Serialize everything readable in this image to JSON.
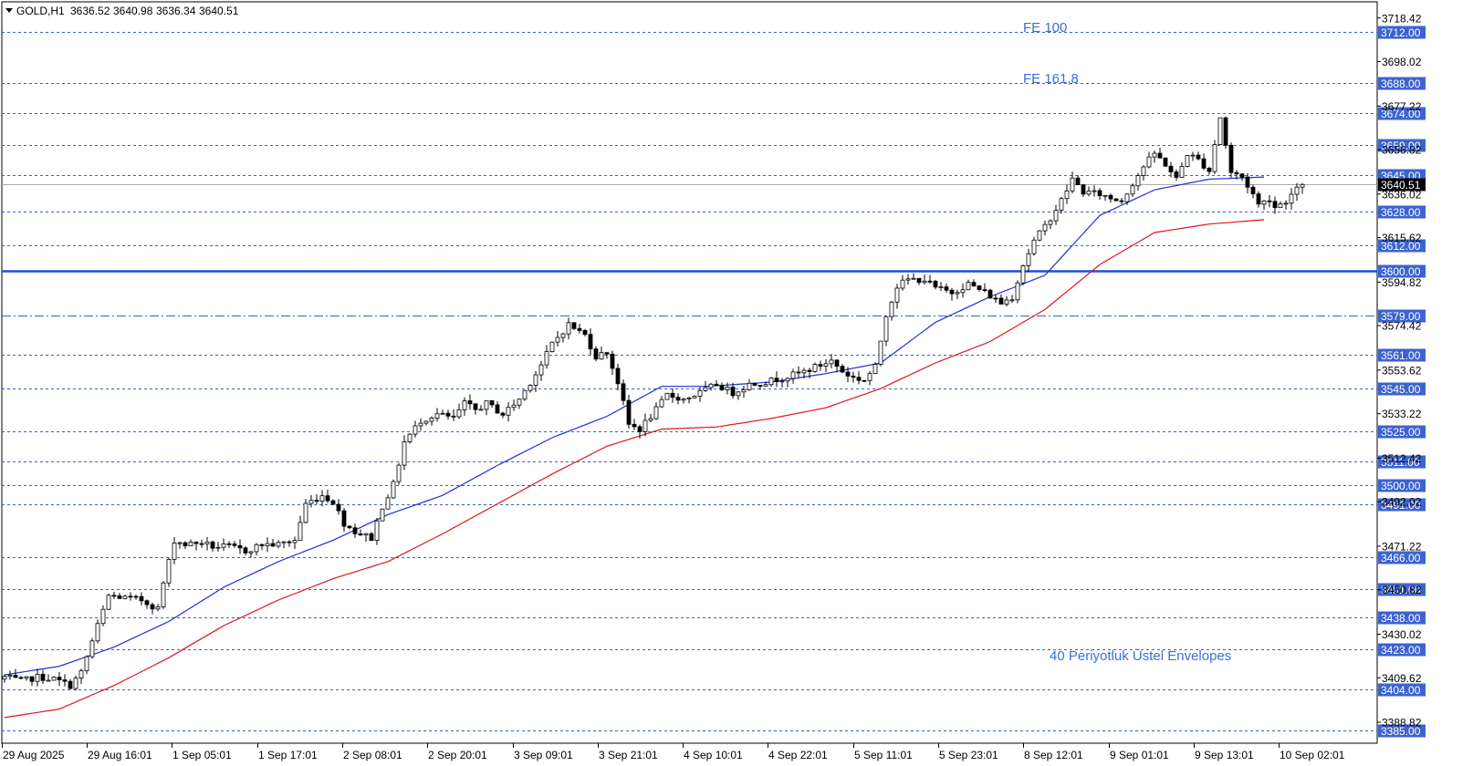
{
  "chart_data": {
    "type": "candlestick",
    "symbol": "GOLD,H1",
    "ohlc_header": [
      "3636.52",
      "3640.98",
      "3636.34",
      "3640.51"
    ],
    "current_price": 3640.51,
    "current_price_label": "3640.51",
    "ylim": [
      3379.0,
      3726.0
    ],
    "y_tick_labels": [
      "3718.42",
      "3698.02",
      "3677.22",
      "3656.82",
      "3636.02",
      "3615.62",
      "3594.82",
      "3574.42",
      "3553.62",
      "3533.22",
      "3512.42",
      "3492.02",
      "3471.22",
      "3450.82",
      "3430.02",
      "3409.62",
      "3388.82"
    ],
    "x_tick_labels": [
      "29 Aug 2025",
      "29 Aug 16:01",
      "1 Sep 05:01",
      "1 Sep 17:01",
      "2 Sep 08:01",
      "2 Sep 20:01",
      "3 Sep 09:01",
      "3 Sep 21:01",
      "4 Sep 10:01",
      "4 Sep 22:01",
      "5 Sep 11:01",
      "5 Sep 23:01",
      "8 Sep 12:01",
      "9 Sep 01:01",
      "9 Sep 13:01",
      "10 Sep 02:01"
    ],
    "levels": [
      {
        "value": 3712.0,
        "label": "3712.00"
      },
      {
        "value": 3688.0,
        "label": "3688.00"
      },
      {
        "value": 3674.0,
        "label": "3674.00"
      },
      {
        "value": 3659.0,
        "label": "3659.00"
      },
      {
        "value": 3645.0,
        "label": "3645.00"
      },
      {
        "value": 3628.0,
        "label": "3628.00"
      },
      {
        "value": 3612.0,
        "label": "3612.00"
      },
      {
        "value": 3600.0,
        "label": "3600.00",
        "style": "solid"
      },
      {
        "value": 3579.0,
        "label": "3579.00",
        "style": "dashdot"
      },
      {
        "value": 3561.0,
        "label": "3561.00"
      },
      {
        "value": 3545.0,
        "label": "3545.00"
      },
      {
        "value": 3525.0,
        "label": "3525.00"
      },
      {
        "value": 3511.0,
        "label": "3511.00"
      },
      {
        "value": 3500.0,
        "label": "3500.00"
      },
      {
        "value": 3491.0,
        "label": "3491.00"
      },
      {
        "value": 3466.0,
        "label": "3466.00"
      },
      {
        "value": 3451.0,
        "label": "3451.00"
      },
      {
        "value": 3438.0,
        "label": "3438.00"
      },
      {
        "value": 3423.0,
        "label": "3423.00"
      },
      {
        "value": 3404.0,
        "label": "3404.00"
      },
      {
        "value": 3385.0,
        "label": "3385.00"
      }
    ],
    "annotations": [
      "FE 100",
      "FE 161,8",
      "40 Periyotluk Üstel Envelopes"
    ],
    "series": [
      {
        "name": "",
        "color": "#1f2fd6",
        "anchors": [
          [
            0,
            3411
          ],
          [
            10,
            3415
          ],
          [
            20,
            3424
          ],
          [
            30,
            3436
          ],
          [
            40,
            3452
          ],
          [
            50,
            3464
          ],
          [
            60,
            3474
          ],
          [
            70,
            3486
          ],
          [
            80,
            3495
          ],
          [
            90,
            3509
          ],
          [
            100,
            3522
          ],
          [
            110,
            3532
          ],
          [
            120,
            3546
          ],
          [
            128,
            3546
          ],
          [
            140,
            3548
          ],
          [
            150,
            3552
          ],
          [
            160,
            3557
          ],
          [
            170,
            3576
          ],
          [
            180,
            3588
          ],
          [
            190,
            3598
          ],
          [
            200,
            3626
          ],
          [
            210,
            3638
          ],
          [
            220,
            3643
          ],
          [
            230,
            3644
          ]
        ]
      },
      {
        "name": "",
        "color": "#e01818",
        "anchors": [
          [
            0,
            3391
          ],
          [
            10,
            3395
          ],
          [
            20,
            3406
          ],
          [
            30,
            3419
          ],
          [
            40,
            3434
          ],
          [
            50,
            3446
          ],
          [
            60,
            3456
          ],
          [
            70,
            3464
          ],
          [
            80,
            3477
          ],
          [
            90,
            3491
          ],
          [
            100,
            3505
          ],
          [
            110,
            3518
          ],
          [
            120,
            3526
          ],
          [
            130,
            3527
          ],
          [
            140,
            3531
          ],
          [
            150,
            3536
          ],
          [
            160,
            3545
          ],
          [
            170,
            3557
          ],
          [
            180,
            3567
          ],
          [
            190,
            3582
          ],
          [
            200,
            3603
          ],
          [
            210,
            3618
          ],
          [
            220,
            3622
          ],
          [
            230,
            3624
          ]
        ]
      }
    ],
    "close_anchors": [
      [
        0,
        3410
      ],
      [
        3,
        3408
      ],
      [
        6,
        3410
      ],
      [
        9,
        3409
      ],
      [
        12,
        3406
      ],
      [
        14,
        3412
      ],
      [
        17,
        3434
      ],
      [
        19,
        3448
      ],
      [
        22,
        3447
      ],
      [
        25,
        3446
      ],
      [
        28,
        3442
      ],
      [
        29,
        3454
      ],
      [
        31,
        3474
      ],
      [
        33,
        3472
      ],
      [
        36,
        3473
      ],
      [
        38,
        3471
      ],
      [
        41,
        3471
      ],
      [
        44,
        3469
      ],
      [
        47,
        3472
      ],
      [
        50,
        3472
      ],
      [
        53,
        3474
      ],
      [
        55,
        3491
      ],
      [
        58,
        3495
      ],
      [
        60,
        3492
      ],
      [
        62,
        3482
      ],
      [
        64,
        3478
      ],
      [
        67,
        3475
      ],
      [
        69,
        3490
      ],
      [
        71,
        3500
      ],
      [
        73,
        3520
      ],
      [
        76,
        3530
      ],
      [
        79,
        3533
      ],
      [
        82,
        3531
      ],
      [
        84,
        3538
      ],
      [
        86,
        3535
      ],
      [
        88,
        3538
      ],
      [
        91,
        3533
      ],
      [
        94,
        3540
      ],
      [
        96,
        3548
      ],
      [
        98,
        3556
      ],
      [
        100,
        3566
      ],
      [
        103,
        3575
      ],
      [
        106,
        3570
      ],
      [
        108,
        3560
      ],
      [
        110,
        3562
      ],
      [
        112,
        3548
      ],
      [
        114,
        3528
      ],
      [
        116,
        3526
      ],
      [
        119,
        3535
      ],
      [
        121,
        3542
      ],
      [
        124,
        3540
      ],
      [
        127,
        3543
      ],
      [
        130,
        3547
      ],
      [
        133,
        3543
      ],
      [
        136,
        3547
      ],
      [
        139,
        3548
      ],
      [
        142,
        3550
      ],
      [
        145,
        3552
      ],
      [
        148,
        3555
      ],
      [
        151,
        3558
      ],
      [
        153,
        3553
      ],
      [
        155,
        3550
      ],
      [
        157,
        3549
      ],
      [
        159,
        3555
      ],
      [
        161,
        3580
      ],
      [
        163,
        3593
      ],
      [
        165,
        3596
      ],
      [
        168,
        3596
      ],
      [
        170,
        3592
      ],
      [
        173,
        3590
      ],
      [
        176,
        3594
      ],
      [
        179,
        3590
      ],
      [
        182,
        3585
      ],
      [
        184,
        3588
      ],
      [
        186,
        3603
      ],
      [
        188,
        3614
      ],
      [
        190,
        3621
      ],
      [
        193,
        3633
      ],
      [
        195,
        3643
      ],
      [
        197,
        3637
      ],
      [
        200,
        3636
      ],
      [
        202,
        3634
      ],
      [
        204,
        3633
      ],
      [
        206,
        3641
      ],
      [
        208,
        3649
      ],
      [
        210,
        3655
      ],
      [
        212,
        3650
      ],
      [
        214,
        3643
      ],
      [
        216,
        3655
      ],
      [
        218,
        3652
      ],
      [
        220,
        3647
      ],
      [
        222,
        3672
      ],
      [
        224,
        3646
      ],
      [
        226,
        3644
      ],
      [
        228,
        3636
      ],
      [
        229,
        3631
      ],
      [
        231,
        3634
      ],
      [
        232,
        3630
      ],
      [
        234,
        3633
      ],
      [
        236,
        3638
      ],
      [
        237,
        3640.51
      ]
    ]
  }
}
